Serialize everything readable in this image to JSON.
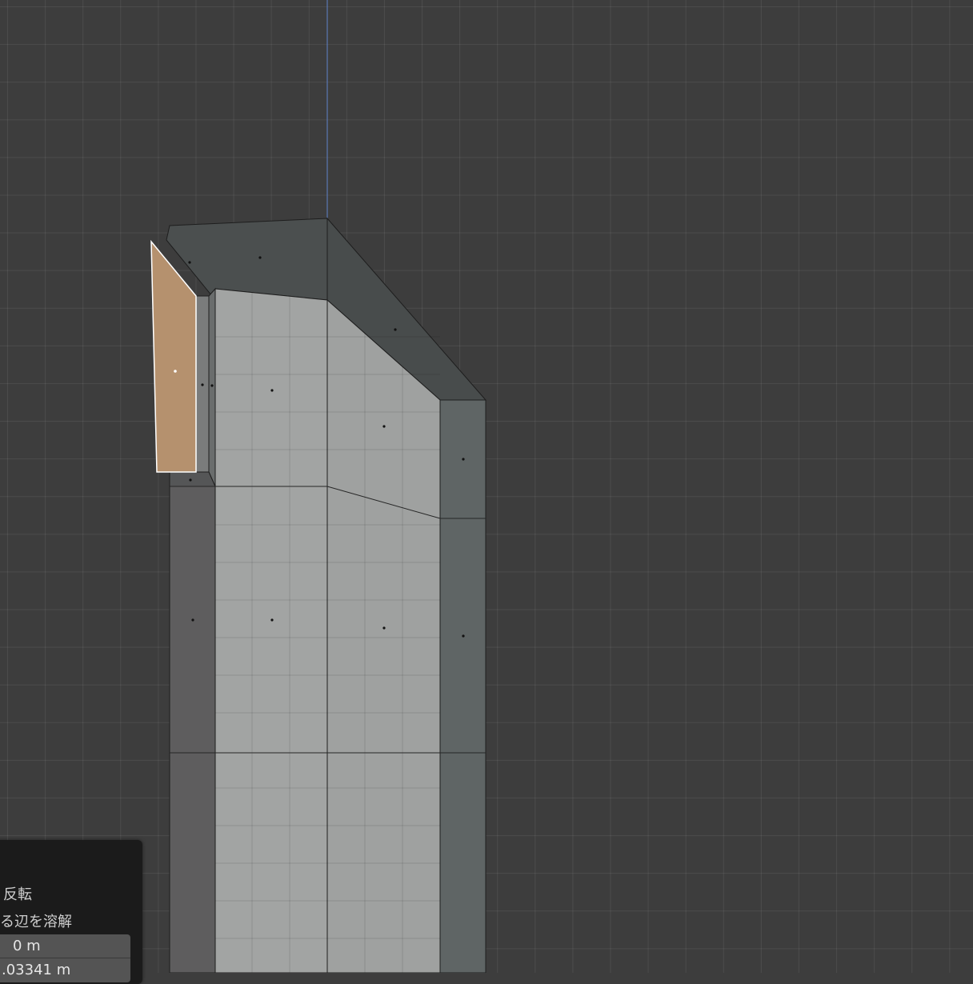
{
  "viewport": {
    "background": "#3d3d3d",
    "axis_color": "#5a78b4",
    "selected_face_color": "#b5916e",
    "mesh_front_color": "#a1a3a2",
    "mesh_side_color": "#5e6464",
    "mesh_top_color": "#4a4d4d"
  },
  "operator_panel": {
    "flip_label": "反転",
    "dissolve_label": "る辺を溶解",
    "fields": [
      {
        "value": "0 m"
      },
      {
        "value": ".03341 m"
      }
    ]
  }
}
